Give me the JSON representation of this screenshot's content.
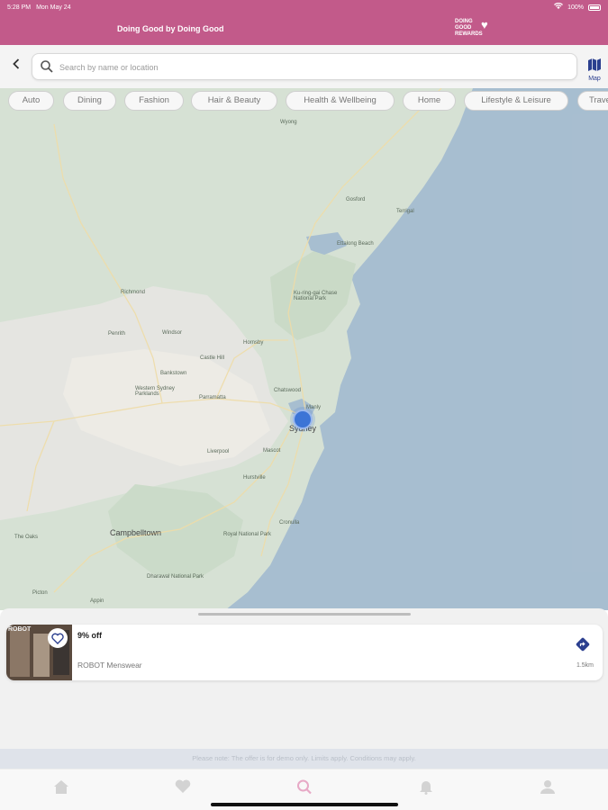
{
  "status_bar": {
    "time": "5:28 PM",
    "date": "Mon May 24",
    "battery": "100%"
  },
  "header": {
    "title": "Doing Good by Doing Good",
    "brand_line1": "DOING",
    "brand_line2": "GOOD",
    "brand_line3": "REWARDS",
    "background_color": "#c25a8a"
  },
  "search": {
    "back_icon": "chevron-left-icon",
    "placeholder": "Search by name or location",
    "value": "",
    "map_toggle_label": "Map"
  },
  "categories": [
    {
      "label": "Auto"
    },
    {
      "label": "Dining"
    },
    {
      "label": "Fashion"
    },
    {
      "label": "Hair & Beauty"
    },
    {
      "label": "Health & Wellbeing"
    },
    {
      "label": "Home"
    },
    {
      "label": "Lifestyle & Leisure"
    },
    {
      "label": "Travel"
    }
  ],
  "map": {
    "labels": [
      {
        "text": "Sydney"
      },
      {
        "text": "Parramatta"
      },
      {
        "text": "Campbelltown"
      },
      {
        "text": "Western Sydney Parklands"
      },
      {
        "text": "Ku-ring-gai Chase National Park"
      },
      {
        "text": "Royal National Park"
      },
      {
        "text": "Gosford"
      },
      {
        "text": "Terrigal"
      },
      {
        "text": "Ettalong Beach"
      },
      {
        "text": "Hornsby"
      },
      {
        "text": "Chatswood"
      },
      {
        "text": "Manly"
      },
      {
        "text": "Bankstown"
      },
      {
        "text": "Liverpool"
      },
      {
        "text": "Penrith"
      },
      {
        "text": "Windsor"
      },
      {
        "text": "Richmond"
      },
      {
        "text": "Castle Hill"
      },
      {
        "text": "Mascot"
      },
      {
        "text": "Hurstville"
      },
      {
        "text": "Cronulla"
      },
      {
        "text": "Wyong"
      },
      {
        "text": "The Oaks"
      },
      {
        "text": "Picton"
      },
      {
        "text": "Appin"
      },
      {
        "text": "Dharawal National Park"
      }
    ]
  },
  "deal": {
    "title": "9% off",
    "merchant": "ROBOT Menswear",
    "distance": "1.5km",
    "thumb_sign": "ROBOT"
  },
  "banner": {
    "text": "Please note: The offer is for demo only. Limits apply. Conditions may apply."
  },
  "tabs": [
    {
      "icon": "home-icon"
    },
    {
      "icon": "heart-icon"
    },
    {
      "icon": "search-icon"
    },
    {
      "icon": "bell-icon"
    },
    {
      "icon": "user-icon"
    }
  ],
  "colors": {
    "accent": "#c25a8a",
    "brand_blue": "#2b3f8f",
    "sea": "#86a5be",
    "land": "#c6d6c4"
  }
}
